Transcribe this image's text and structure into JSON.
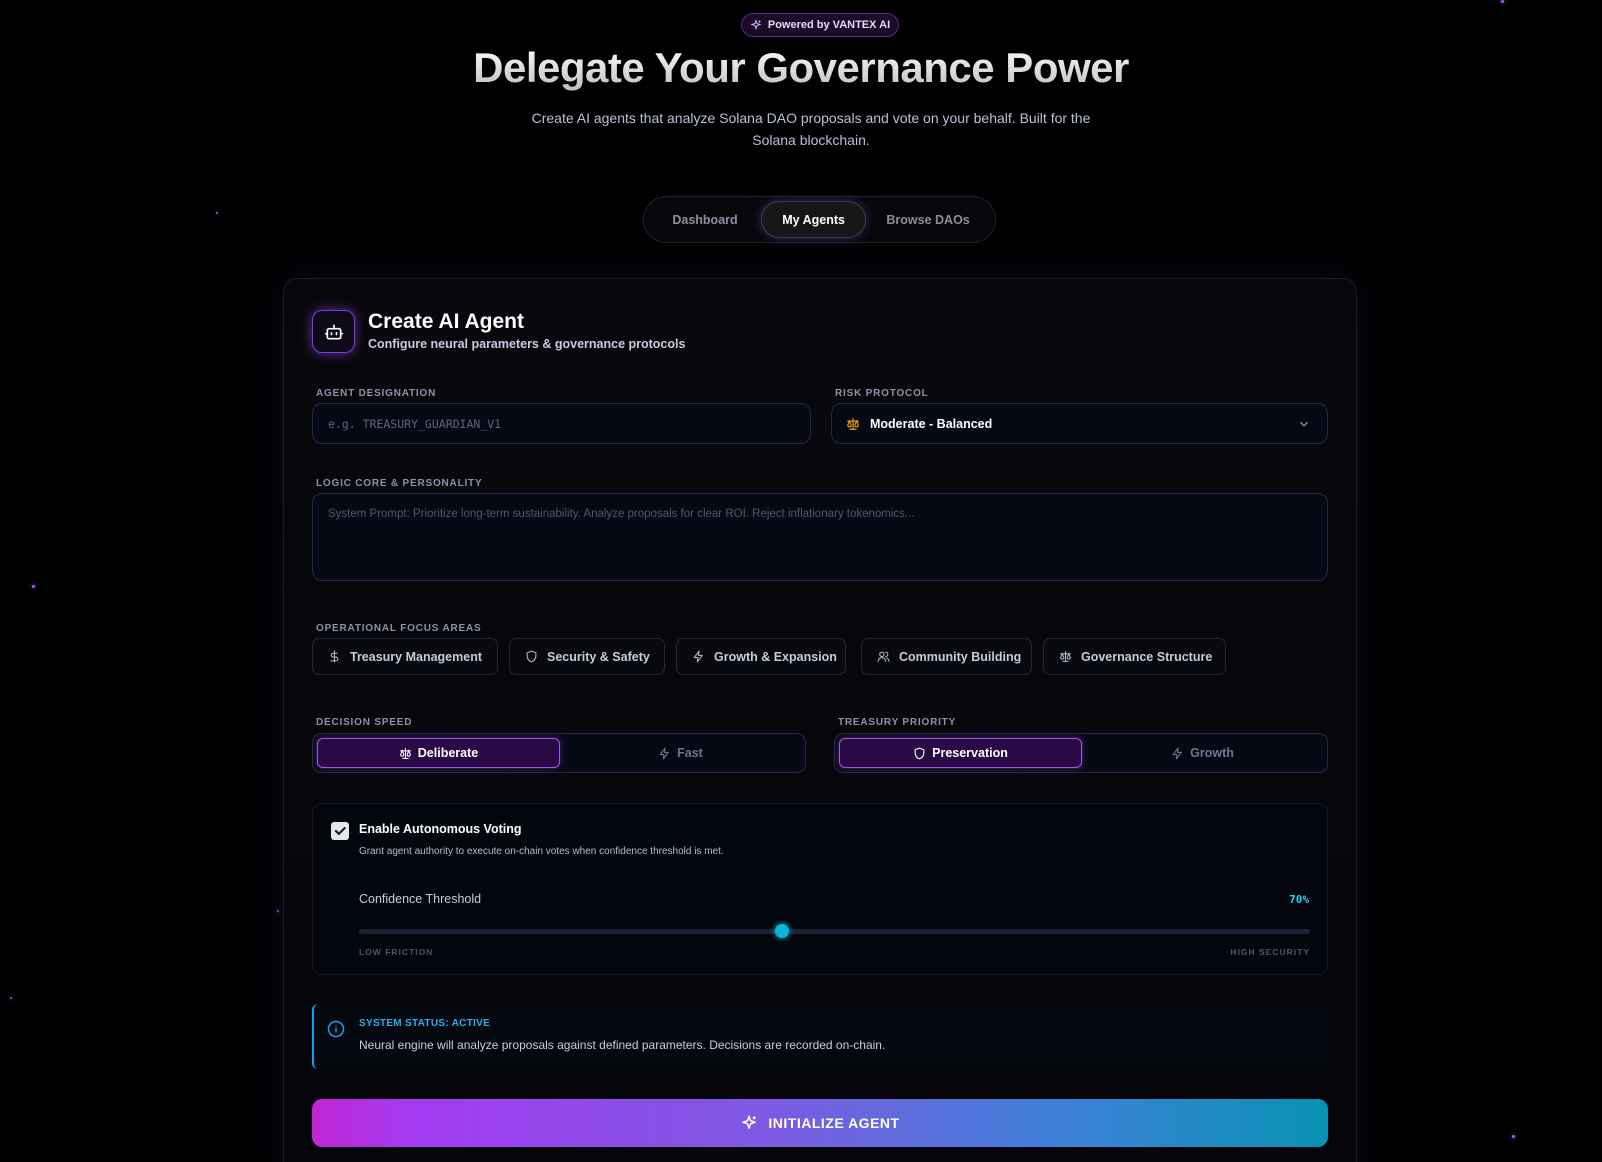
{
  "hero": {
    "badge": "Powered by VANTEX AI",
    "title": "Delegate Your Governance Power",
    "subtitle_line1": "Create AI agents that analyze Solana DAO proposals and vote on your behalf. Built for the",
    "subtitle_line2": "Solana blockchain."
  },
  "nav": {
    "tabs": [
      "Dashboard",
      "My Agents",
      "Browse DAOs"
    ],
    "active": "My Agents"
  },
  "form": {
    "title": "Create AI Agent",
    "subtitle": "Configure neural parameters & governance protocols",
    "designation": {
      "label": "AGENT DESIGNATION",
      "placeholder": "e.g. TREASURY_GUARDIAN_V1"
    },
    "risk": {
      "label": "RISK PROTOCOL",
      "value": "Moderate - Balanced"
    },
    "logic": {
      "label": "LOGIC CORE & PERSONALITY",
      "placeholder": "System Prompt: Prioritize long-term sustainability. Analyze proposals for clear ROI. Reject inflationary tokenomics..."
    },
    "focus": {
      "label": "OPERATIONAL FOCUS AREAS",
      "chips": [
        {
          "label": "Treasury Management",
          "icon": "dollar-icon"
        },
        {
          "label": "Security & Safety",
          "icon": "shield-icon"
        },
        {
          "label": "Growth & Expansion",
          "icon": "lightning-icon"
        },
        {
          "label": "Community Building",
          "icon": "users-icon"
        },
        {
          "label": "Governance Structure",
          "icon": "scale-icon"
        }
      ]
    },
    "decision_speed": {
      "label": "DECISION SPEED",
      "options": [
        "Deliberate",
        "Fast"
      ],
      "selected": "Deliberate"
    },
    "treasury_priority": {
      "label": "TREASURY PRIORITY",
      "options": [
        "Preservation",
        "Growth"
      ],
      "selected": "Preservation"
    },
    "autonomous": {
      "title": "Enable Autonomous Voting",
      "description": "Grant agent authority to execute on-chain votes when confidence threshold is met.",
      "checked": true,
      "threshold_label": "Confidence Threshold",
      "threshold_value": "70%",
      "threshold_fraction": 0.445,
      "low_label": "LOW FRICTION",
      "high_label": "HIGH SECURITY"
    },
    "status": {
      "title": "SYSTEM STATUS: ACTIVE",
      "text": "Neural engine will analyze proposals against defined parameters. Decisions are recorded on-chain."
    },
    "submit_label": "INITIALIZE AGENT"
  },
  "colors": {
    "accent_purple": "#a855f7",
    "accent_cyan": "#22d3ee",
    "status_blue": "#0ea5e9",
    "risk_icon": "#f59e0b"
  }
}
